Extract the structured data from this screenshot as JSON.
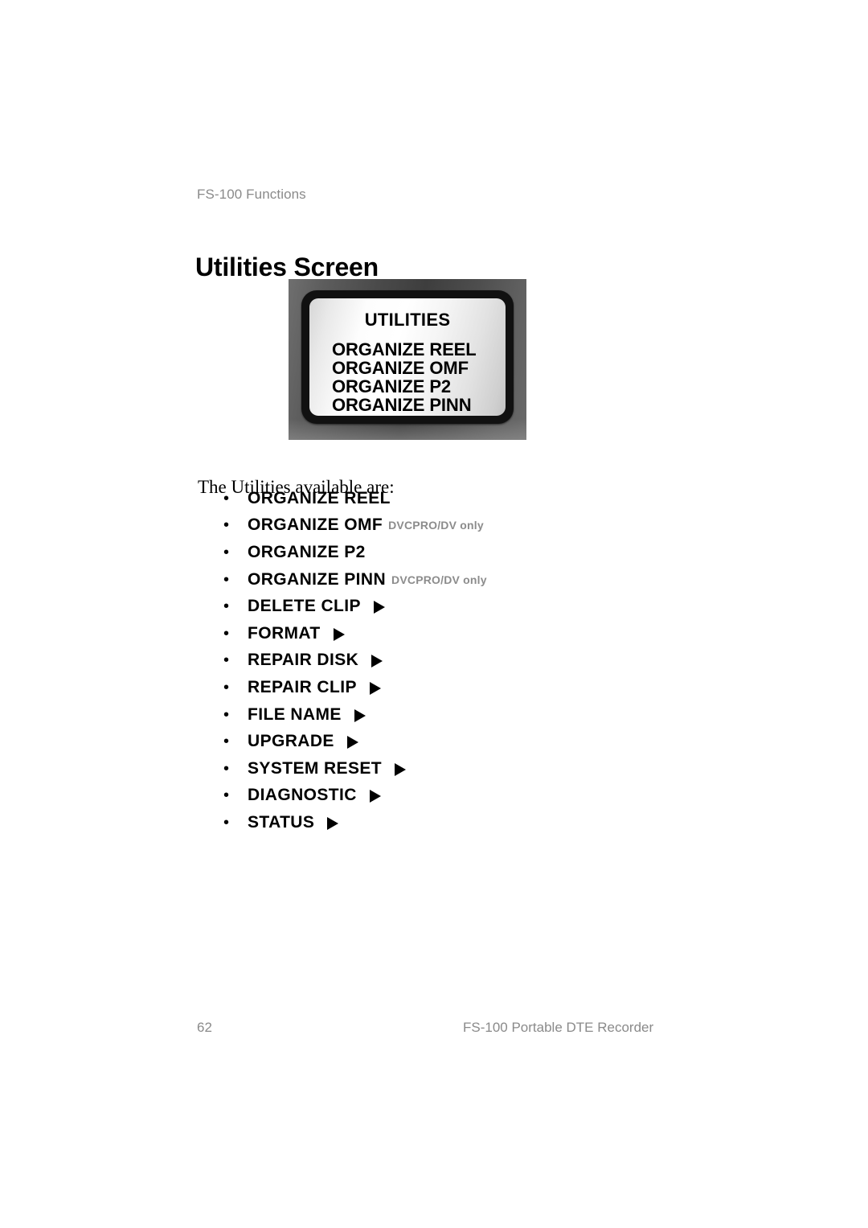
{
  "header": {
    "running_head": "FS-100 Functions"
  },
  "title": "Utilities Screen",
  "lcd": {
    "screen_title": "UTILITIES",
    "menu_items": [
      "ORGANIZE REEL",
      "ORGANIZE OMF",
      "ORGANIZE P2",
      "ORGANIZE PINN"
    ],
    "frame_color": "#4a4a4a",
    "bezel_color": "#111111",
    "screen_color": "#f4f4f4"
  },
  "intro": "The Utilities available are:",
  "utilities": [
    {
      "bullet": "•",
      "label": "ORGANIZE REEL",
      "note": "",
      "arrow": false
    },
    {
      "bullet": "•",
      "label": "ORGANIZE OMF",
      "note": "DVCPRO/DV only",
      "arrow": false
    },
    {
      "bullet": "•",
      "label": "ORGANIZE P2",
      "note": "",
      "arrow": false
    },
    {
      "bullet": "•",
      "label": "ORGANIZE PINN",
      "note": "DVCPRO/DV only",
      "arrow": false
    },
    {
      "bullet": "•",
      "label": "DELETE CLIP",
      "note": "",
      "arrow": true
    },
    {
      "bullet": "•",
      "label": "FORMAT",
      "note": "",
      "arrow": true
    },
    {
      "bullet": "•",
      "label": "REPAIR DISK",
      "note": "",
      "arrow": true
    },
    {
      "bullet": "•",
      "label": "REPAIR CLIP",
      "note": "",
      "arrow": true
    },
    {
      "bullet": "•",
      "label": "FILE NAME",
      "note": "",
      "arrow": true
    },
    {
      "bullet": "•",
      "label": "UPGRADE",
      "note": "",
      "arrow": true
    },
    {
      "bullet": "•",
      "label": "SYSTEM RESET",
      "note": "",
      "arrow": true
    },
    {
      "bullet": "•",
      "label": "DIAGNOSTIC",
      "note": "",
      "arrow": true
    },
    {
      "bullet": "•",
      "label": "STATUS",
      "note": "",
      "arrow": true
    }
  ],
  "footer": {
    "page_number": "62",
    "product_name": "FS-100 Portable DTE Recorder"
  },
  "colors": {
    "text": "#000000",
    "muted": "#8a8a8a",
    "note": "#8c8c8c"
  }
}
